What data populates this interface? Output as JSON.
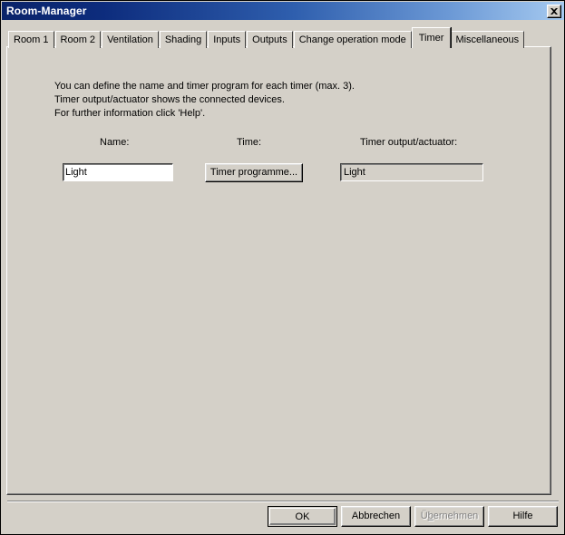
{
  "window": {
    "title": "Room-Manager",
    "close_icon": "close-icon"
  },
  "tabs": [
    {
      "label": "Room 1",
      "selected": false
    },
    {
      "label": "Room 2",
      "selected": false
    },
    {
      "label": "Ventilation",
      "selected": false
    },
    {
      "label": "Shading",
      "selected": false
    },
    {
      "label": "Inputs",
      "selected": false
    },
    {
      "label": "Outputs",
      "selected": false
    },
    {
      "label": "Change operation mode",
      "selected": false
    },
    {
      "label": "Timer",
      "selected": true
    },
    {
      "label": "Miscellaneous",
      "selected": false
    }
  ],
  "panel": {
    "instructions": [
      "You can define the name and timer program for each timer (max. 3).",
      "Timer output/actuator shows the connected devices.",
      "For further information click 'Help'."
    ],
    "columns": {
      "name": "Name:",
      "time": "Time:",
      "output": "Timer output/actuator:"
    },
    "row": {
      "name_value": "Light ",
      "name_placeholder": "",
      "time_button_label": "Timer programme...",
      "output_value": "Light"
    }
  },
  "buttons": {
    "ok": "OK",
    "cancel": "Abbrechen",
    "apply_before": "Ü",
    "apply_accel": "b",
    "apply_after": "ernehmen",
    "help": "Hilfe"
  },
  "colors": {
    "face": "#d4d0c8",
    "title_start": "#0a246a",
    "title_end": "#a6caf0",
    "field_bg": "#ffffff",
    "disabled_text": "#808080"
  }
}
